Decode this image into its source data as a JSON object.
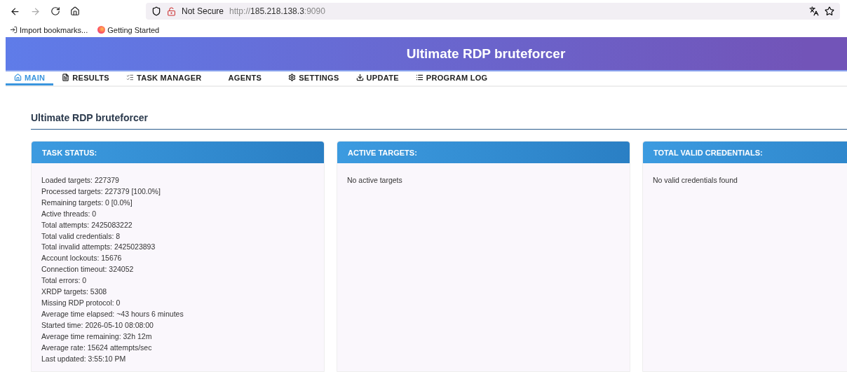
{
  "browser": {
    "security": "Not Secure",
    "url_prefix": "http://",
    "url_host": "185.218.138.3",
    "url_port": ":9090"
  },
  "bookmarks": [
    {
      "label": "Import bookmarks...",
      "kind": "import"
    },
    {
      "label": "Getting Started",
      "kind": "browser"
    }
  ],
  "banner": {
    "title": "Ultimate RDP bruteforcer"
  },
  "tabs": [
    {
      "label": "MAIN",
      "kind": "home",
      "selected": true
    },
    {
      "label": "RESULTS",
      "kind": "document",
      "selected": false
    },
    {
      "label": "TASK MANAGER",
      "kind": "checklist",
      "selected": false
    },
    {
      "label": "AGENTS",
      "kind": "plain",
      "selected": false
    },
    {
      "label": "SETTINGS",
      "kind": "settings",
      "selected": false
    },
    {
      "label": "UPDATE",
      "kind": "download",
      "selected": false
    },
    {
      "label": "PROGRAM LOG",
      "kind": "log",
      "selected": false
    }
  ],
  "heading": "Ultimate RDP bruteforcer",
  "cards": [
    {
      "title": "TASK STATUS:",
      "lines": [
        "Loaded targets: 227379",
        "Processed targets: 227379 [100.0%]",
        "Remaining targets: 0 [0.0%]",
        "Active threads: 0",
        "Total attempts: 2425083222",
        "Total valid credentials: 8",
        "Total invalid attempts: 2425023893",
        "Account lockouts: 15676",
        "Connection timeout: 324052",
        "Total errors: 0",
        "XRDP targets: 5308",
        "Missing RDP protocol: 0",
        "Average time elapsed: ~43 hours 6 minutes",
        "Started time: 2026-05-10 08:08:00",
        "Average time remaining: 32h 12m",
        "Average rate: 15624 attempts/sec",
        "Last updated: 3:55:10 PM"
      ]
    },
    {
      "title": "ACTIVE TARGETS:",
      "lines": [
        "No active targets"
      ]
    },
    {
      "title": "TOTAL VALID CREDENTIALS:",
      "lines": [
        "No valid credentials found"
      ]
    }
  ]
}
